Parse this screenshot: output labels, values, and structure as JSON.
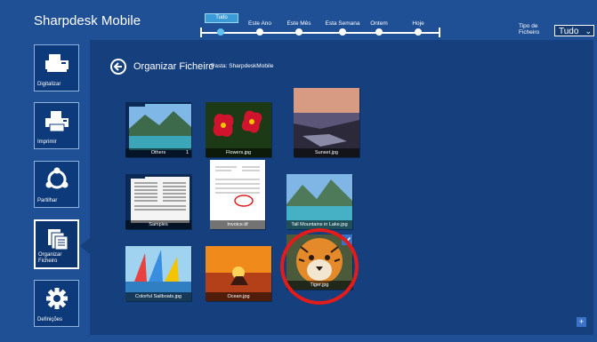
{
  "app": {
    "title": "Sharpdesk Mobile"
  },
  "timeline": {
    "tooltip": "Tudo",
    "labels": [
      "Este Ano",
      "Este Mês",
      "Esta Semana",
      "Ontem",
      "Hoje"
    ]
  },
  "filter": {
    "label": "Tipo de Ficheiro",
    "value": "Tudo"
  },
  "sidebar": {
    "items": [
      {
        "label": "Digitalizar",
        "icon": "scanner-icon"
      },
      {
        "label": "Imprimir",
        "icon": "printer-icon"
      },
      {
        "label": "Partilhar",
        "icon": "share-icon"
      },
      {
        "label": "Organizar Ficheiro",
        "icon": "organize-files-icon"
      },
      {
        "label": "Definições",
        "icon": "gear-icon"
      }
    ]
  },
  "main": {
    "title": "Organizar Ficheiro",
    "path": "Pasta: SharpdeskMobile"
  },
  "files": [
    {
      "name": "Others",
      "count": "1",
      "thumb": "folder-landscape"
    },
    {
      "name": "Flowers.jpg",
      "thumb": "flowers"
    },
    {
      "name": "Sunset.jpg",
      "thumb": "sunset-coast"
    },
    {
      "name": "Samples",
      "thumb": "document-folder"
    },
    {
      "name": "Invoice.tif",
      "thumb": "invoice"
    },
    {
      "name": "Tall Mountains in Lake.jpg",
      "thumb": "mountain-lake"
    },
    {
      "name": "Colorful Sailboats.jpg",
      "thumb": "sailboats"
    },
    {
      "name": "Ocean.jpg",
      "thumb": "ocean-sunset"
    },
    {
      "name": "Tiger.jpg",
      "thumb": "tiger",
      "selected": true
    }
  ],
  "colors": {
    "background": "#1f4f95",
    "panel": "#153f7d",
    "accent": "#5ec1f2",
    "highlight": "#e21b1b"
  }
}
